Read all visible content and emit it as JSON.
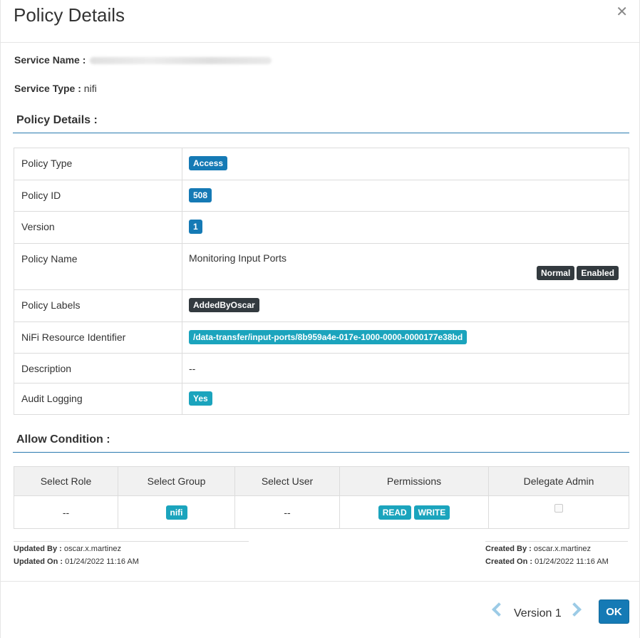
{
  "dialog": {
    "title": "Policy Details",
    "close_icon": "close-icon"
  },
  "service": {
    "name_label": "Service Name :",
    "name_value": "",
    "type_label": "Service Type :",
    "type_value": "nifi"
  },
  "policy_section": {
    "heading": "Policy Details :"
  },
  "policy": {
    "type_label": "Policy Type",
    "type_value": "Access",
    "id_label": "Policy ID",
    "id_value": "508",
    "version_label": "Version",
    "version_value": "1",
    "name_label": "Policy Name",
    "name_value": "Monitoring Input Ports",
    "status_normal": "Normal",
    "status_enabled": "Enabled",
    "labels_label": "Policy Labels",
    "labels_value": "AddedByOscar",
    "resource_label": "NiFi Resource Identifier",
    "resource_value": "/data-transfer/input-ports/8b959a4e-017e-1000-0000-0000177e38bd",
    "description_label": "Description",
    "description_value": "--",
    "audit_label": "Audit Logging",
    "audit_value": "Yes"
  },
  "allow_section": {
    "heading": "Allow Condition :"
  },
  "allow_table": {
    "headers": [
      "Select Role",
      "Select Group",
      "Select User",
      "Permissions",
      "Delegate Admin"
    ],
    "row": {
      "role": "--",
      "group": "nifi",
      "user": "--",
      "permissions": [
        "READ",
        "WRITE"
      ],
      "delegate_admin": false
    }
  },
  "meta": {
    "updated_by_label": "Updated By :",
    "updated_by": "oscar.x.martinez",
    "updated_on_label": "Updated On :",
    "updated_on": "01/24/2022 11:16 AM",
    "created_by_label": "Created By :",
    "created_by": "oscar.x.martinez",
    "created_on_label": "Created On :",
    "created_on": "01/24/2022 11:16 AM"
  },
  "footer": {
    "version_label": "Version 1",
    "prev_icon": "chevron-left-icon",
    "next_icon": "chevron-right-icon",
    "ok_label": "OK"
  },
  "colors": {
    "primary": "#157ab5",
    "teal": "#1ba4bd",
    "dark": "#333a3f",
    "rule": "#2a7aaf"
  }
}
